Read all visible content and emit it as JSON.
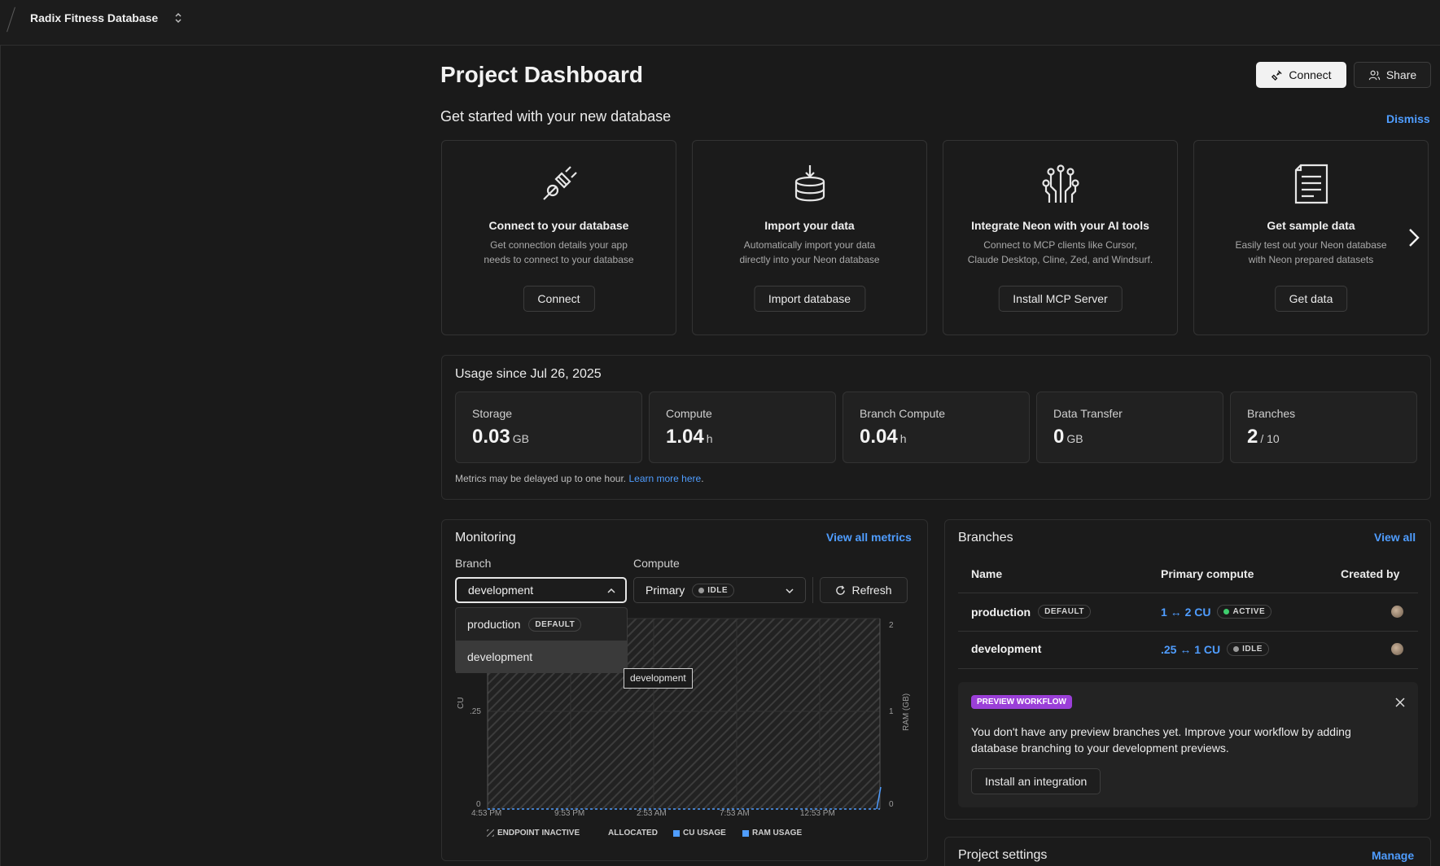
{
  "header": {
    "project_name": "Radix Fitness Database"
  },
  "page": {
    "title": "Project Dashboard",
    "connect_label": "Connect",
    "share_label": "Share"
  },
  "get_started": {
    "title": "Get started with your new database",
    "dismiss_label": "Dismiss",
    "cards": [
      {
        "icon": "plug-icon",
        "title": "Connect to your database",
        "desc1": "Get connection details your app",
        "desc2": "needs to connect to your database",
        "button": "Connect"
      },
      {
        "icon": "database-import-icon",
        "title": "Import your data",
        "desc1": "Automatically import your data",
        "desc2": "directly into your Neon database",
        "button": "Import database"
      },
      {
        "icon": "circuit-ai-icon",
        "title": "Integrate Neon with your AI tools",
        "desc1": "Connect to MCP clients like Cursor,",
        "desc2": "Claude Desktop, Cline, Zed, and Windsurf.",
        "button": "Install MCP Server"
      },
      {
        "icon": "document-icon",
        "title": "Get sample data",
        "desc1": "Easily test out your Neon database",
        "desc2": "with Neon prepared datasets",
        "button": "Get data"
      }
    ]
  },
  "usage": {
    "title": "Usage since Jul 26, 2025",
    "metrics": [
      {
        "label": "Storage",
        "value": "0.03",
        "unit": "GB"
      },
      {
        "label": "Compute",
        "value": "1.04",
        "unit": "h"
      },
      {
        "label": "Branch Compute",
        "value": "0.04",
        "unit": "h"
      },
      {
        "label": "Data Transfer",
        "value": "0",
        "unit": "GB"
      },
      {
        "label": "Branches",
        "value": "2",
        "unit": "/ 10"
      }
    ],
    "note": "Metrics may be delayed up to one hour.",
    "learn_more": "Learn more here"
  },
  "monitoring": {
    "title": "Monitoring",
    "view_all": "View all metrics",
    "branch_label": "Branch",
    "compute_label": "Compute",
    "branch_value": "development",
    "compute_value": "Primary",
    "compute_status": "IDLE",
    "refresh_label": "Refresh",
    "dropdown": [
      {
        "name": "production",
        "badge": "DEFAULT"
      },
      {
        "name": "development",
        "badge": ""
      }
    ],
    "tooltip": "development",
    "chart": {
      "left_axis_label": "CU",
      "right_axis_label": "RAM (GB)",
      "left_ticks": [
        ".25",
        "0"
      ],
      "right_ticks": [
        "2",
        "1",
        "0"
      ],
      "x_ticks": [
        "4:53 PM",
        "9:53 PM",
        "2:53 AM",
        "7:53 AM",
        "12:53 PM"
      ],
      "legend": [
        {
          "label": "ENDPOINT INACTIVE",
          "color": "#8a8a8a"
        },
        {
          "label": "ALLOCATED",
          "color": "#1b1b1b"
        },
        {
          "label": "CU USAGE",
          "color": "#4f9dff"
        },
        {
          "label": "RAM USAGE",
          "color": "#4f9dff"
        }
      ]
    }
  },
  "branches": {
    "title": "Branches",
    "view_all": "View all",
    "col_name": "Name",
    "col_compute": "Primary compute",
    "col_created": "Created by",
    "rows": [
      {
        "name": "production",
        "badge": "DEFAULT",
        "compute": "1 ↔ 2 CU",
        "status": "ACTIVE",
        "status_color": "#3ecf6e"
      },
      {
        "name": "development",
        "badge": "",
        "compute": ".25 ↔ 1 CU",
        "status": "IDLE",
        "status_color": "#9a9a9a"
      }
    ],
    "preview": {
      "badge": "PREVIEW WORKFLOW",
      "text1": "You don't have any preview branches yet. Improve your workflow by adding",
      "text2": "database branching to your development previews.",
      "button": "Install an integration"
    }
  },
  "project_settings": {
    "title": "Project settings",
    "manage": "Manage"
  },
  "colors": {
    "accent": "#4f9dff",
    "preview_purple": "#9b3fd8",
    "active_green": "#3ecf6e"
  }
}
